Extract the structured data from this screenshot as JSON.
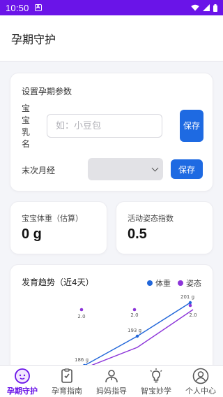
{
  "status_bar": {
    "time": "10:50"
  },
  "app_bar": {
    "title": "孕期守护"
  },
  "setup_card": {
    "title": "设置孕期参数",
    "baby_name_label": "宝宝乳名",
    "baby_name_placeholder": "如：小豆包",
    "baby_name_value": "",
    "save_label_vertical": "保存",
    "lmp_label": "末次月经",
    "lmp_value": "",
    "save_label": "保存"
  },
  "stats": [
    {
      "label": "宝宝体重（估算）",
      "value": "0 g"
    },
    {
      "label": "活动姿态指数",
      "value": "0.5"
    }
  ],
  "chart_data": {
    "type": "line",
    "title": "发育趋势（近4天）",
    "series": [
      {
        "name": "体重",
        "color": "#2166d9",
        "x": [
          2,
          3,
          4
        ],
        "values": [
          186,
          193,
          201
        ],
        "labels": [
          "186 g",
          "193 g",
          "201 g"
        ]
      },
      {
        "name": "姿态",
        "color": "#8c35d9",
        "x": [
          1,
          2,
          3,
          4
        ],
        "values": [
          2.0,
          2.0,
          2.0,
          2.0
        ],
        "labels": [
          "2.0",
          "2.0",
          "2.0",
          "2.0"
        ]
      }
    ]
  },
  "tab_bar": {
    "active": 0,
    "tabs": [
      {
        "label": "孕期守护",
        "icon": "baby-face-icon"
      },
      {
        "label": "孕育指南",
        "icon": "checklist-icon"
      },
      {
        "label": "妈妈指导",
        "icon": "doctor-icon"
      },
      {
        "label": "智宝妙学",
        "icon": "lightbulb-icon"
      },
      {
        "label": "个人中心",
        "icon": "person-icon"
      }
    ]
  }
}
